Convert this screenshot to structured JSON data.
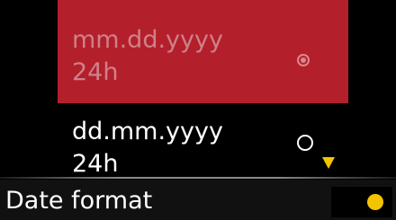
{
  "options": [
    {
      "line1": "mm.dd.yyyy",
      "line2": "24h",
      "selected": true
    },
    {
      "line1": "dd.mm.yyyy",
      "line2": "24h",
      "selected": false
    }
  ],
  "footer": {
    "title": "Date format"
  },
  "icons": {
    "radio_selected": "radio-selected-icon",
    "radio_unselected": "radio-unselected-icon",
    "scroll_down": "triangle-down-icon",
    "status": "yellow-dot-icon"
  },
  "colors": {
    "background": "#000000",
    "selection": "#b41f2c",
    "accent": "#f5c400",
    "text": "#ffffff",
    "selected_text": "#cf8088"
  }
}
